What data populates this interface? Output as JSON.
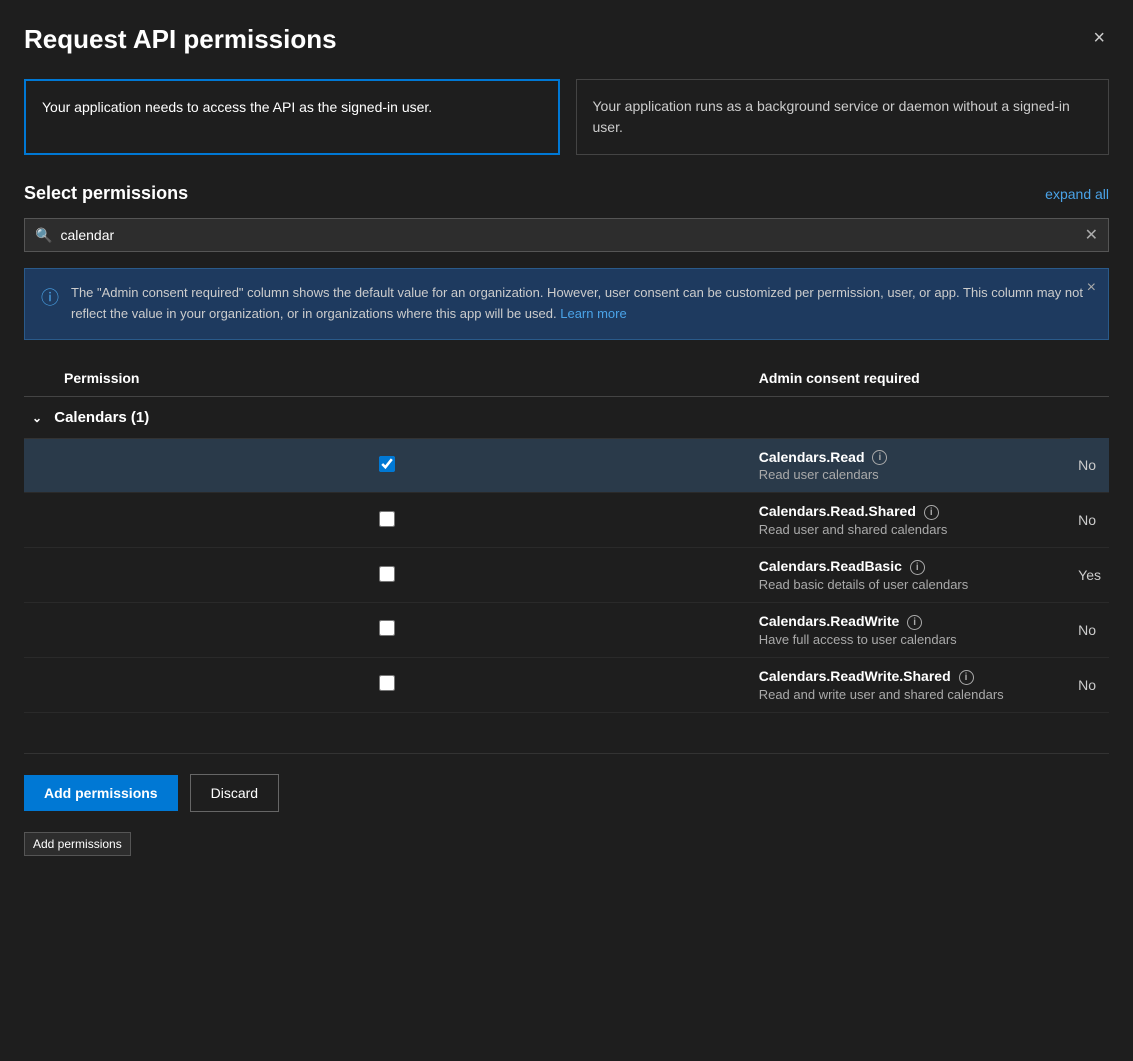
{
  "dialog": {
    "title": "Request API permissions",
    "close_label": "×"
  },
  "option_cards": [
    {
      "id": "delegated",
      "text": "Your application needs to access the API as the signed-in user.",
      "selected": true
    },
    {
      "id": "application",
      "text": "Your application runs as a background service or daemon without a signed-in user.",
      "selected": false
    }
  ],
  "select_permissions": {
    "label": "Select permissions",
    "expand_all_label": "expand all"
  },
  "search": {
    "value": "calendar",
    "placeholder": "Search permissions"
  },
  "info_banner": {
    "text": "The \"Admin consent required\" column shows the default value for an organization. However, user consent can be customized per permission, user, or app. This column may not reflect the value in your organization, or in organizations where this app will be used.",
    "link_text": "Learn more",
    "close_label": "×"
  },
  "table": {
    "col_permission": "Permission",
    "col_admin_consent": "Admin consent required",
    "groups": [
      {
        "name": "Calendars (1)",
        "expanded": true,
        "permissions": [
          {
            "id": "calendars-read",
            "name": "Calendars.Read",
            "description": "Read user calendars",
            "admin_consent": "No",
            "checked": true
          },
          {
            "id": "calendars-read-shared",
            "name": "Calendars.Read.Shared",
            "description": "Read user and shared calendars",
            "admin_consent": "No",
            "checked": false
          },
          {
            "id": "calendars-readbasic",
            "name": "Calendars.ReadBasic",
            "description": "Read basic details of user calendars",
            "admin_consent": "Yes",
            "checked": false
          },
          {
            "id": "calendars-readwrite",
            "name": "Calendars.ReadWrite",
            "description": "Have full access to user calendars",
            "admin_consent": "No",
            "checked": false
          },
          {
            "id": "calendars-readwrite-shared",
            "name": "Calendars.ReadWrite.Shared",
            "description": "Read and write user and shared calendars",
            "admin_consent": "No",
            "checked": false
          }
        ]
      }
    ]
  },
  "footer": {
    "add_permissions_label": "Add permissions",
    "discard_label": "Discard",
    "tooltip_label": "Add permissions"
  }
}
